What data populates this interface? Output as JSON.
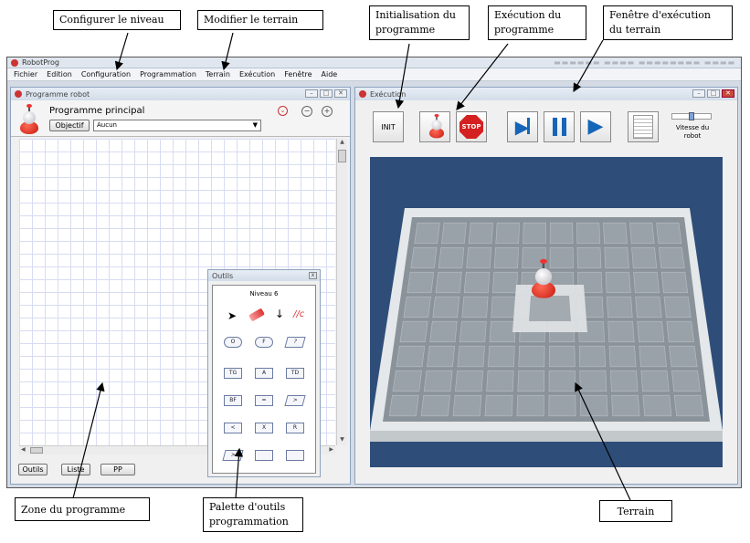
{
  "callouts": {
    "configurer": "Configurer le niveau",
    "modifier": "Modifier le terrain",
    "initialisation": "Initialisation du programme",
    "execution_prog": "Exécution du programme",
    "fenetre": "Fenêtre d'exécution du terrain",
    "zone": "Zone du programme",
    "palette": "Palette d'outils programmation",
    "terrain": "Terrain"
  },
  "app": {
    "title": "RobotProg",
    "menu": [
      "Fichier",
      "Edition",
      "Configuration",
      "Programmation",
      "Terrain",
      "Exécution",
      "Fenêtre",
      "Aide"
    ]
  },
  "program_window": {
    "title": "Programme robot",
    "heading": "Programme principal",
    "objectif_label": "Objectif",
    "select_value": "Aucun",
    "bottom_buttons": [
      "Outils",
      "Liste",
      "PP"
    ]
  },
  "tools_palette": {
    "title": "Outils",
    "level": "Niveau 6",
    "cells": [
      "O",
      "F",
      "?",
      "TG",
      "A",
      "TD",
      "BF",
      "=",
      ">",
      "<",
      "X",
      "R",
      ">",
      "",
      ""
    ]
  },
  "execution_window": {
    "title": "Exécution",
    "init_label": "INIT",
    "stop_label": "STOP",
    "speed_label": "Vitesse du robot"
  },
  "colors": {
    "terrain_bg": "#2e4e79",
    "stop_red": "#d42020",
    "play_blue": "#1565b8"
  }
}
